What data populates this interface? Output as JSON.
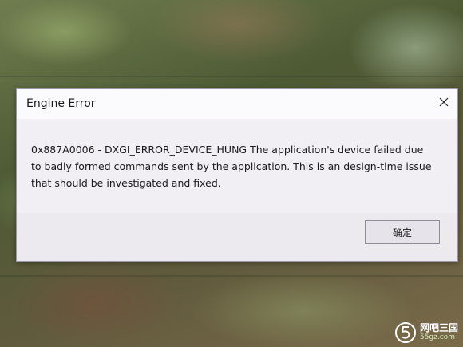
{
  "dialog": {
    "title": "Engine Error",
    "message": "0x887A0006 - DXGI_ERROR_DEVICE_HUNG The application's device failed due to badly formed commands sent by the application. This is an design-time issue that should be investigated and fixed.",
    "ok_label": "确定",
    "close_icon": "close-icon"
  },
  "watermark": {
    "name": "网吧三国",
    "site": "55gz.com"
  }
}
